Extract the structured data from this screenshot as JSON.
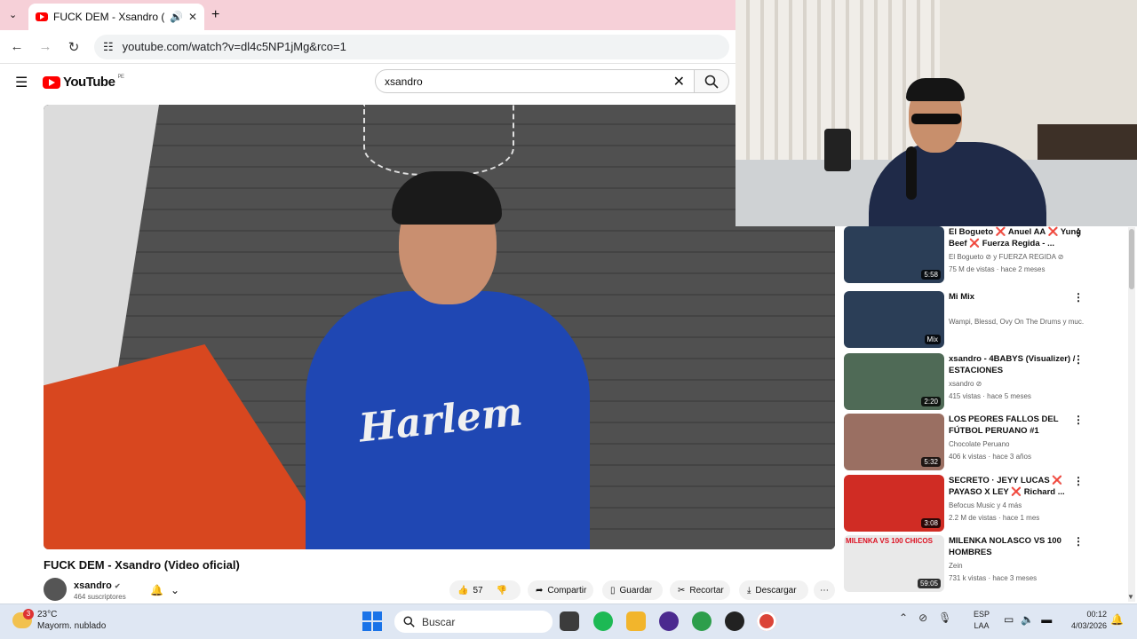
{
  "browser": {
    "tab_title": "FUCK DEM - Xsandro (Vide",
    "new_tab": "+",
    "close_tab": "✕",
    "url": "youtube.com/watch?v=dl4c5NP1jMg&rco=1"
  },
  "youtube": {
    "logo_text": "YouTube",
    "logo_region": "PE",
    "search_value": "xsandro"
  },
  "video": {
    "shirt_text": "Harlem",
    "title": "FUCK DEM - Xsandro (Video oficial)",
    "channel": "xsandro",
    "subscribers": "464 suscriptores",
    "likes": "57",
    "share": "Compartir",
    "save": "Guardar",
    "clip": "Recortar",
    "download": "Descargar"
  },
  "recommendations": [
    {
      "title": "El Bogueto ❌ Anuel AA ❌ Yung Beef ❌ Fuerza Regida - ...",
      "channel": "El Bogueto ⊘ y FUERZA REGIDA ⊘",
      "meta": "75 M de vistas · hace 2 meses",
      "duration": "5:58",
      "color": "#2b3e57"
    },
    {
      "title": "Mi Mix",
      "channel": "Wampi, Blessd, Ovy On The Drums y muc...",
      "meta": "",
      "duration": "Mix",
      "color": "#2b3e57"
    },
    {
      "title": "xsandro - 4BABYS (Visualizer) / ESTACIONES",
      "channel": "xsandro ⊘",
      "meta": "415 vistas · hace 5 meses",
      "duration": "2:20",
      "color": "#4f6a56"
    },
    {
      "title": "LOS PEORES FALLOS DEL FÚTBOL PERUANO #1",
      "channel": "Chocolate Peruano",
      "meta": "406 k vistas · hace 3 años",
      "duration": "5:32",
      "color": "#9a6f62"
    },
    {
      "title": "SECRETO · JEYY LUCAS ❌ PAYASO X LEY ❌ Richard ...",
      "channel": "Befocus Music y 4 más",
      "meta": "2.2 M de vistas · hace 1 mes",
      "duration": "3:08",
      "color": "#d02c24"
    },
    {
      "title": "MILENKA NOLASCO VS 100 HOMBRES",
      "channel": "Zein",
      "meta": "731 k vistas · hace 3 meses",
      "duration": "59:05",
      "color": "#e9e9e9",
      "thumb_text": "MILENKA VS 100 CHICOS"
    }
  ],
  "taskbar": {
    "weather_badge": "3",
    "temperature": "23°C",
    "weather_desc": "Mayorm. nublado",
    "search_placeholder": "Buscar",
    "lang_1": "ESP",
    "lang_2": "LAA",
    "time": "00:12",
    "date": "4/03/2026"
  }
}
